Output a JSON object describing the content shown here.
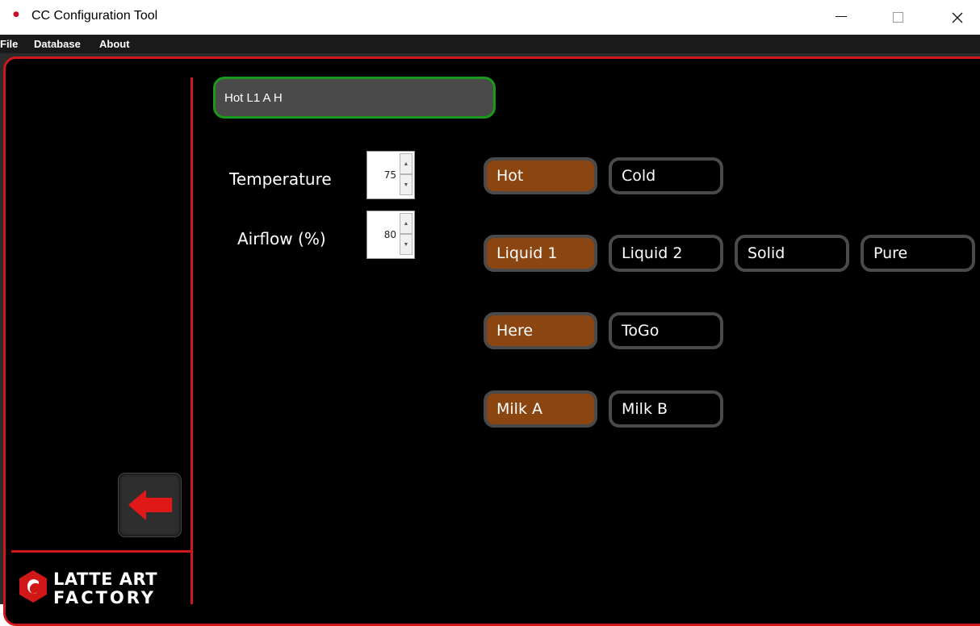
{
  "window": {
    "title": "CC Configuration Tool"
  },
  "menu": {
    "items": [
      "File",
      "Database",
      "About"
    ]
  },
  "config": {
    "name_value": "Hot L1 A H"
  },
  "fields": {
    "temperature": {
      "label": "Temperature",
      "value": "75"
    },
    "airflow": {
      "label": "Airflow (%)",
      "value": "80"
    }
  },
  "options": {
    "temperature_mode": [
      {
        "label": "Hot",
        "selected": true
      },
      {
        "label": "Cold",
        "selected": false
      }
    ],
    "medium": [
      {
        "label": "Liquid 1",
        "selected": true
      },
      {
        "label": "Liquid 2",
        "selected": false
      },
      {
        "label": "Solid",
        "selected": false
      },
      {
        "label": "Pure",
        "selected": false
      }
    ],
    "location": [
      {
        "label": "Here",
        "selected": true
      },
      {
        "label": "ToGo",
        "selected": false
      }
    ],
    "milk": [
      {
        "label": "Milk A",
        "selected": true
      },
      {
        "label": "Milk B",
        "selected": false
      }
    ]
  },
  "logo": {
    "line1": "LATTE ART",
    "line2": "FACTORY"
  },
  "colors": {
    "accent_red": "#d11818",
    "selected_brown": "#8a4510",
    "field_border_green": "#1a9a1a"
  },
  "icons": {
    "back": "arrow-left-icon",
    "minimize": "minimize-icon",
    "maximize": "maximize-icon",
    "close": "close-icon"
  }
}
